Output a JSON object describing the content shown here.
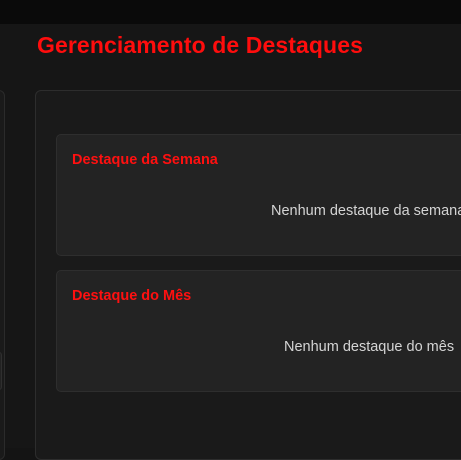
{
  "page": {
    "title": "Gerenciamento de Destaques"
  },
  "highlights": {
    "week": {
      "title": "Destaque da Semana",
      "empty_message": "Nenhum destaque da semana"
    },
    "month": {
      "title": "Destaque do Mês",
      "empty_message": "Nenhum destaque do mês"
    }
  },
  "colors": {
    "accent": "#ff0d0d",
    "background": "#161616",
    "card": "#232323",
    "text": "#d4d4d4"
  }
}
